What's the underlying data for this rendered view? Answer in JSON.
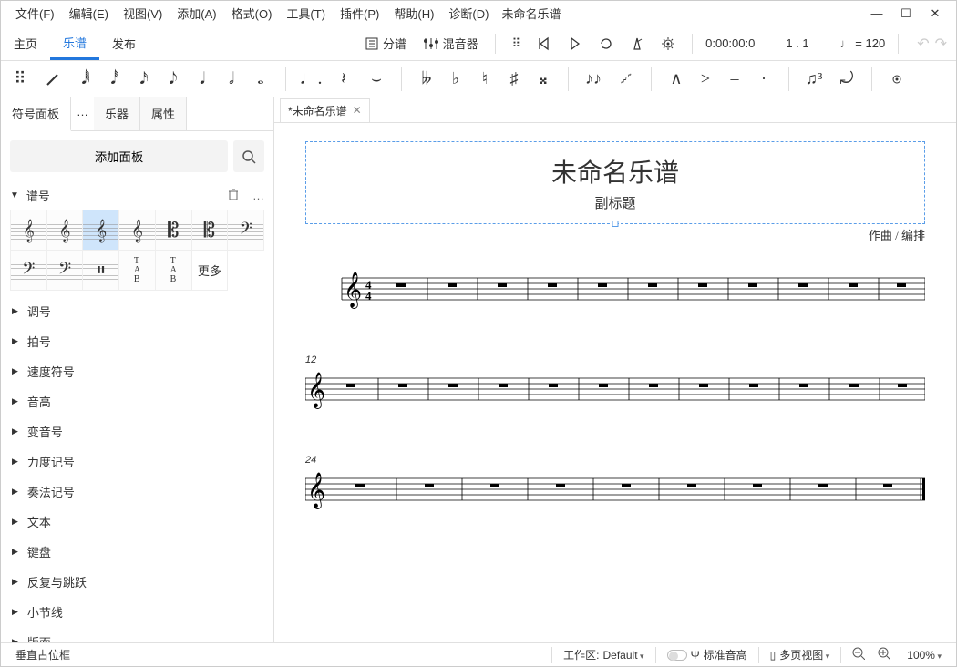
{
  "menu": [
    "文件(F)",
    "编辑(E)",
    "视图(V)",
    "添加(A)",
    "格式(O)",
    "工具(T)",
    "插件(P)",
    "帮助(H)",
    "诊断(D)"
  ],
  "window_title": "未命名乐谱",
  "tabs": {
    "home": "主页",
    "score": "乐谱",
    "publish": "发布"
  },
  "header_right": {
    "parts_label": "分谱",
    "mixer_label": "混音器",
    "time": "0:00:00:0",
    "position": "1 . 1",
    "tempo_glyph": "♩ =",
    "tempo_value": "120"
  },
  "note_toolbar": {
    "durations": [
      "𝅘𝅥𝅱",
      "𝅘𝅥𝅰",
      "𝅘𝅥𝅯",
      "𝅘𝅥𝅮",
      "𝅘𝅥",
      "𝅗𝅥",
      "𝅝"
    ],
    "dot": "·",
    "rest": "𝄽",
    "tie": "⌣",
    "accidentals": [
      "𝄫",
      "♭",
      "♮",
      "♯",
      "𝄪"
    ],
    "voice_flip": "♪♪",
    "slur": "𝆱",
    "artic": [
      "∧",
      ">",
      "–",
      "·"
    ],
    "tuplet": "♫³",
    "flip": "⤾"
  },
  "side": {
    "tab_palette": "符号面板",
    "tab_instr": "乐器",
    "tab_props": "属性",
    "add_panel": "添加面板",
    "section_clef": "谱号",
    "more": "更多",
    "categories": [
      "调号",
      "拍号",
      "速度符号",
      "音高",
      "变音号",
      "力度记号",
      "奏法记号",
      "文本",
      "键盘",
      "反复与跳跃",
      "小节线",
      "版面"
    ]
  },
  "doc_tab": "*未命名乐谱",
  "score": {
    "title": "未命名乐谱",
    "subtitle": "副标题",
    "composer": "作曲 / 编排",
    "measure_numbers": [
      "",
      "12",
      "24"
    ]
  },
  "status": {
    "left": "垂直占位框",
    "workspace_label": "工作区:",
    "workspace_value": "Default",
    "concert_pitch": "标准音高",
    "view_mode": "多页视图",
    "zoom": "100%"
  }
}
